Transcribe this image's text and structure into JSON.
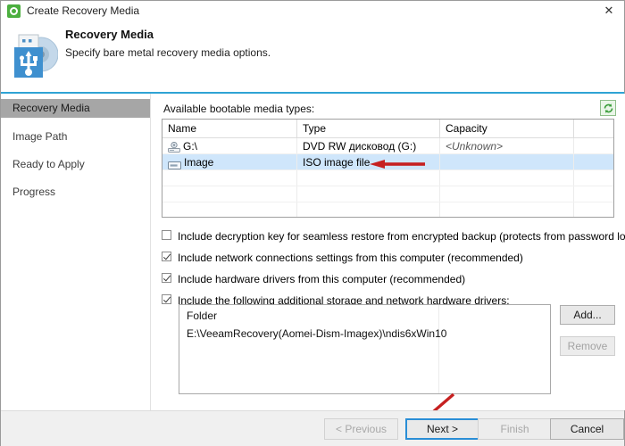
{
  "window": {
    "title": "Create Recovery Media",
    "title_icon": "recovery-app-icon",
    "close_icon": "close-icon"
  },
  "header": {
    "title": "Recovery Media",
    "subtitle": "Specify bare metal recovery media options.",
    "icon": "usb-disc-media-icon",
    "accent_color": "#2fa3d4"
  },
  "sidebar": {
    "items": [
      {
        "label": "Recovery Media",
        "active": true
      },
      {
        "label": "Image Path",
        "active": false
      },
      {
        "label": "Ready to Apply",
        "active": false
      },
      {
        "label": "Progress",
        "active": false
      }
    ],
    "active_bg": "#a6a6a6"
  },
  "main": {
    "media_label": "Available bootable media types:",
    "refresh_icon": "refresh-icon",
    "table": {
      "columns": [
        "Name",
        "Type",
        "Capacity",
        ""
      ],
      "rows": [
        {
          "name": "G:\\",
          "type": "DVD RW дисковод (G:)",
          "capacity": "<Unknown>",
          "extra": "",
          "icon": "optical-drive-icon",
          "selected": false,
          "capacity_italic": true
        },
        {
          "name": "Image",
          "type": "ISO image file",
          "capacity": "",
          "extra": "",
          "icon": "iso-file-icon",
          "selected": true,
          "capacity_italic": false
        }
      ],
      "empty_rows": 4,
      "selection_color": "#cfe6fb"
    },
    "checkboxes": [
      {
        "label": "Include decryption key for seamless restore from encrypted backup (protects from password loss)",
        "checked": false
      },
      {
        "label": "Include network connections settings from this computer (recommended)",
        "checked": true
      },
      {
        "label": "Include hardware drivers from this computer (recommended)",
        "checked": true
      },
      {
        "label": "Include the following additional storage and network hardware drivers:",
        "checked": true
      }
    ],
    "folder_list": {
      "header": "Folder",
      "items": [
        "E:\\VeeamRecovery(Aomei-Dism-Imagex)\\ndis6xWin10"
      ]
    },
    "side_buttons": [
      {
        "label": "Add...",
        "disabled": false
      },
      {
        "label": "Remove",
        "disabled": true
      }
    ]
  },
  "annotations": {
    "table_arrow": {
      "name": "red-arrow-left",
      "color": "#c62020"
    },
    "next_arrow": {
      "name": "red-arrow-diagonal",
      "color": "#c62020"
    }
  },
  "footer": {
    "buttons": [
      {
        "label": "< Previous",
        "disabled": true,
        "default": false
      },
      {
        "label": "Next >",
        "disabled": false,
        "default": true
      },
      {
        "label": "Finish",
        "disabled": true,
        "default": false
      },
      {
        "label": "Cancel",
        "disabled": false,
        "default": false
      }
    ],
    "focus_color": "#2a8ed6"
  }
}
